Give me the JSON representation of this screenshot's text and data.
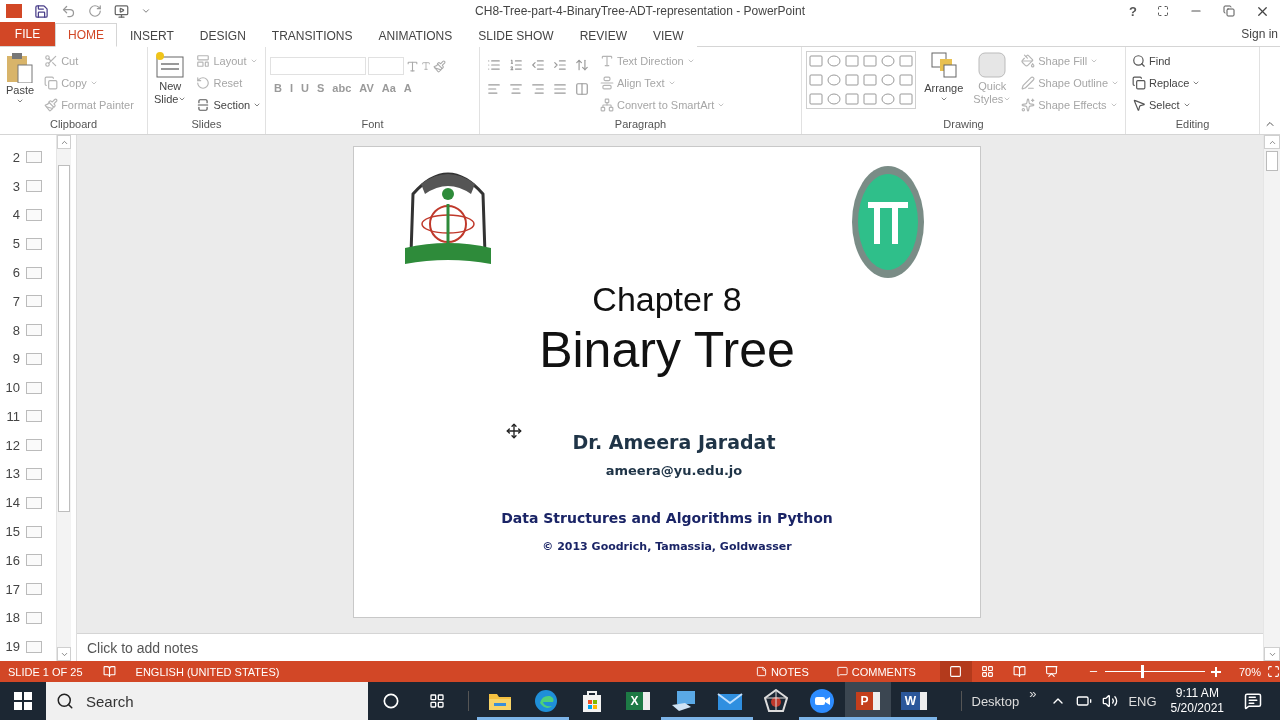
{
  "window": {
    "title": "CH8-Tree-part-4-BinaryTree-ADT-representation - PowerPoint",
    "help": "?",
    "sign_in": "Sign in"
  },
  "ribbon_tabs": [
    {
      "label": "FILE",
      "kind": "file",
      "selected": false
    },
    {
      "label": "HOME",
      "kind": "tab",
      "selected": true
    },
    {
      "label": "INSERT",
      "kind": "tab",
      "selected": false
    },
    {
      "label": "DESIGN",
      "kind": "tab",
      "selected": false
    },
    {
      "label": "TRANSITIONS",
      "kind": "tab",
      "selected": false
    },
    {
      "label": "ANIMATIONS",
      "kind": "tab",
      "selected": false
    },
    {
      "label": "SLIDE SHOW",
      "kind": "tab",
      "selected": false
    },
    {
      "label": "REVIEW",
      "kind": "tab",
      "selected": false
    },
    {
      "label": "VIEW",
      "kind": "tab",
      "selected": false
    }
  ],
  "clipboard": {
    "label": "Clipboard",
    "paste": "Paste",
    "items": [
      {
        "label": "Cut",
        "disabled": true
      },
      {
        "label": "Copy",
        "disabled": true
      },
      {
        "label": "Format Painter",
        "disabled": true
      }
    ]
  },
  "slides_group": {
    "label": "Slides",
    "new_slide": [
      "New",
      "Slide"
    ],
    "items": [
      {
        "label": "Layout",
        "disabled": true
      },
      {
        "label": "Reset",
        "disabled": true
      },
      {
        "label": "Section",
        "disabled": false
      }
    ]
  },
  "font": {
    "label": "Font",
    "format_buttons": [
      "B",
      "I",
      "U",
      "S",
      "abc",
      "AV",
      "Aa",
      "A"
    ]
  },
  "paragraph": {
    "label": "Paragraph",
    "items": [
      {
        "label": "Text Direction",
        "disabled": true
      },
      {
        "label": "Align Text",
        "disabled": true
      },
      {
        "label": "Convert to SmartArt",
        "disabled": true
      }
    ]
  },
  "drawing": {
    "label": "Drawing",
    "arrange": "Arrange",
    "quick_styles": [
      "Quick",
      "Styles"
    ],
    "items": [
      {
        "label": "Shape Fill",
        "disabled": true
      },
      {
        "label": "Shape Outline",
        "disabled": true
      },
      {
        "label": "Shape Effects",
        "disabled": true
      }
    ]
  },
  "editing": {
    "label": "Editing",
    "items": [
      {
        "label": "Find",
        "disabled": false
      },
      {
        "label": "Replace",
        "disabled": false
      },
      {
        "label": "Select",
        "disabled": false
      }
    ]
  },
  "thumbnails": [
    "2",
    "3",
    "4",
    "5",
    "6",
    "7",
    "8",
    "9",
    "10",
    "11",
    "12",
    "13",
    "14",
    "15",
    "16",
    "17",
    "18",
    "19"
  ],
  "slide": {
    "title": "Chapter 8",
    "heading": "Binary Tree",
    "author": "Dr. Ameera Jaradat",
    "email": "ameera@yu.edu.jo",
    "course": "Data Structures and Algorithms in Python",
    "copyright": "© 2013 Goodrich, Tamassia, Goldwasser"
  },
  "notes_placeholder": "Click to add notes",
  "status_bar": {
    "slide": "SLIDE 1 OF 25",
    "language": "ENGLISH (UNITED STATES)",
    "notes": "NOTES",
    "comments": "COMMENTS",
    "views": [
      {
        "selected": true
      },
      {
        "selected": false
      },
      {
        "selected": false
      },
      {
        "selected": false
      }
    ],
    "zoom": {
      "level": 0.36,
      "reading": "70%"
    }
  },
  "taskbar": {
    "search_placeholder": "Search",
    "apps": [
      {
        "kind": "folder",
        "running": true,
        "selected": false
      },
      {
        "kind": "browser",
        "running": true,
        "selected": false
      },
      {
        "kind": "store",
        "running": false,
        "selected": false
      },
      {
        "kind": "sheet",
        "letter": "X",
        "running": false,
        "selected": false
      },
      {
        "kind": "computer",
        "running": true,
        "selected": false
      },
      {
        "kind": "mail",
        "running": true,
        "selected": false
      },
      {
        "kind": "web",
        "running": false,
        "selected": false
      },
      {
        "kind": "video",
        "running": true,
        "selected": false
      },
      {
        "kind": "slides",
        "letter": "P",
        "running": true,
        "selected": true
      },
      {
        "kind": "doc",
        "letter": "W",
        "running": true,
        "selected": false
      }
    ],
    "desktop": "Desktop",
    "chevron": "»",
    "language": "ENG",
    "time": "9:11 AM",
    "date": "5/20/2021"
  }
}
